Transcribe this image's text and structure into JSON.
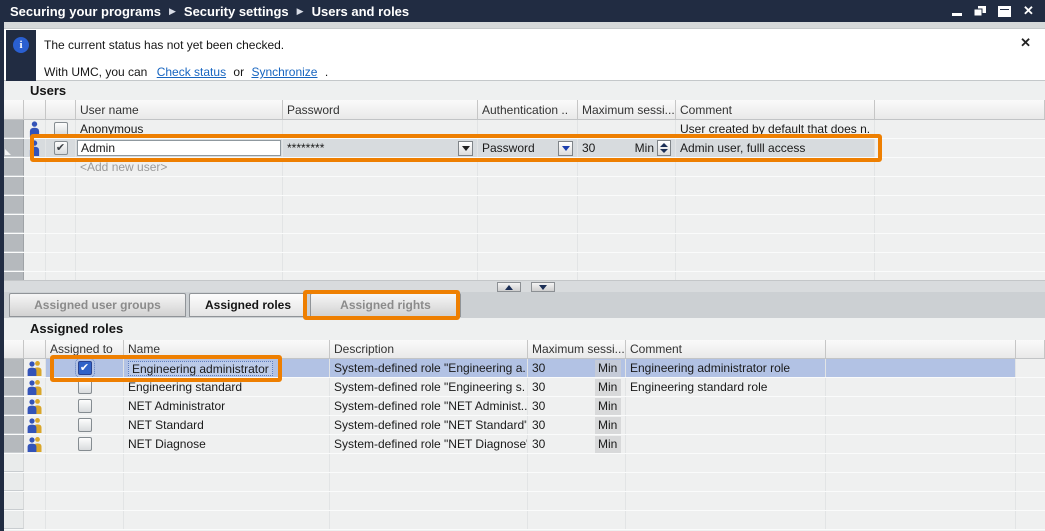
{
  "titlebar": {
    "items": [
      "Securing your programs",
      "Security settings",
      "Users and roles"
    ],
    "separator": "▶"
  },
  "banner": {
    "message": "The current status has not yet been checked.",
    "prefix": "With UMC, you can",
    "link_check": "Check status",
    "conjunction": "or",
    "link_sync": "Synchronize",
    "suffix": ".",
    "close_glyph": "✕"
  },
  "users": {
    "title": "Users",
    "headers": {
      "name": "User name",
      "password": "Password",
      "auth": "Authentication ..",
      "max": "Maximum sessi...",
      "comment": "Comment"
    },
    "rows": [
      {
        "state": "unchecked",
        "name": "Anonymous",
        "password": "",
        "auth": "",
        "max": "",
        "unit": "",
        "comment": "User created by default that does n."
      },
      {
        "state": "checked",
        "name": "Admin",
        "password": "********",
        "auth": "Password",
        "max": "30",
        "unit": "Min",
        "comment": "Admin user, fulll access"
      },
      {
        "state": "",
        "name": "<Add new user>",
        "password": "",
        "auth": "",
        "max": "",
        "unit": "",
        "comment": ""
      }
    ]
  },
  "tabs": {
    "groups": "Assigned user groups",
    "roles": "Assigned roles",
    "rights": "Assigned rights"
  },
  "roles": {
    "title": "Assigned roles",
    "headers": {
      "assigned": "Assigned to",
      "name": "Name",
      "description": "Description",
      "max": "Maximum sessi...",
      "comment": "Comment"
    },
    "rows": [
      {
        "state": "checked",
        "name": "Engineering administrator",
        "description": "System-defined role \"Engineering a.",
        "max": "30",
        "unit": "Min",
        "comment": "Engineering administrator role"
      },
      {
        "state": "unchecked",
        "name": "Engineering standard",
        "description": "System-defined role \"Engineering s.",
        "max": "30",
        "unit": "Min",
        "comment": "Engineering standard role"
      },
      {
        "state": "unchecked",
        "name": "NET Administrator",
        "description": "System-defined role \"NET Administ...",
        "max": "30",
        "unit": "Min",
        "comment": ""
      },
      {
        "state": "unchecked",
        "name": "NET Standard",
        "description": "System-defined role \"NET Standard\"",
        "max": "30",
        "unit": "Min",
        "comment": ""
      },
      {
        "state": "unchecked",
        "name": "NET Diagnose",
        "description": "System-defined role \"NET Diagnose\"",
        "max": "30",
        "unit": "Min",
        "comment": ""
      }
    ]
  },
  "colors": {
    "titlebar_navy": "#212c42",
    "accent_orange": "#ee7f01",
    "selection_blue": "#b2c2e4",
    "link_blue": "#1765c0",
    "info_icon_blue": "#2a5fd0"
  }
}
